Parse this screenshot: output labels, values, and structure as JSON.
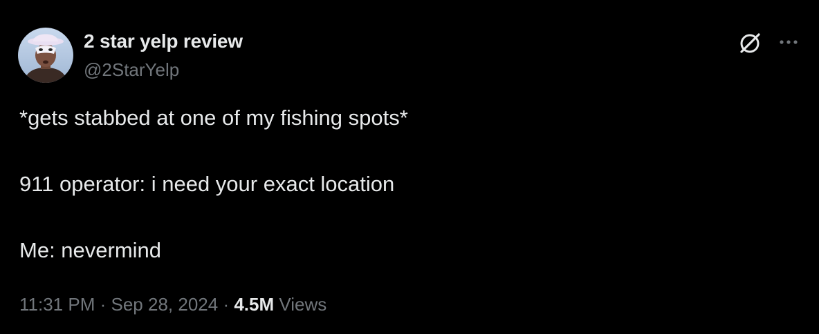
{
  "author": {
    "display_name": "2 star yelp review",
    "handle": "@2StarYelp",
    "avatar_icon": "avatar-masked-man"
  },
  "header_actions": {
    "grok_icon": "grok-icon",
    "more_icon": "more-options-icon"
  },
  "tweet": {
    "lines": [
      "*gets stabbed at one of my fishing spots*",
      "911 operator: i need your exact location",
      "Me: nevermind"
    ]
  },
  "meta": {
    "time": "11:31 PM",
    "separator": "·",
    "date": "Sep 28, 2024",
    "views_count": "4.5M",
    "views_label": "Views"
  },
  "colors": {
    "background": "#000000",
    "primary_text": "#e7e9ea",
    "secondary_text": "#71767b"
  }
}
